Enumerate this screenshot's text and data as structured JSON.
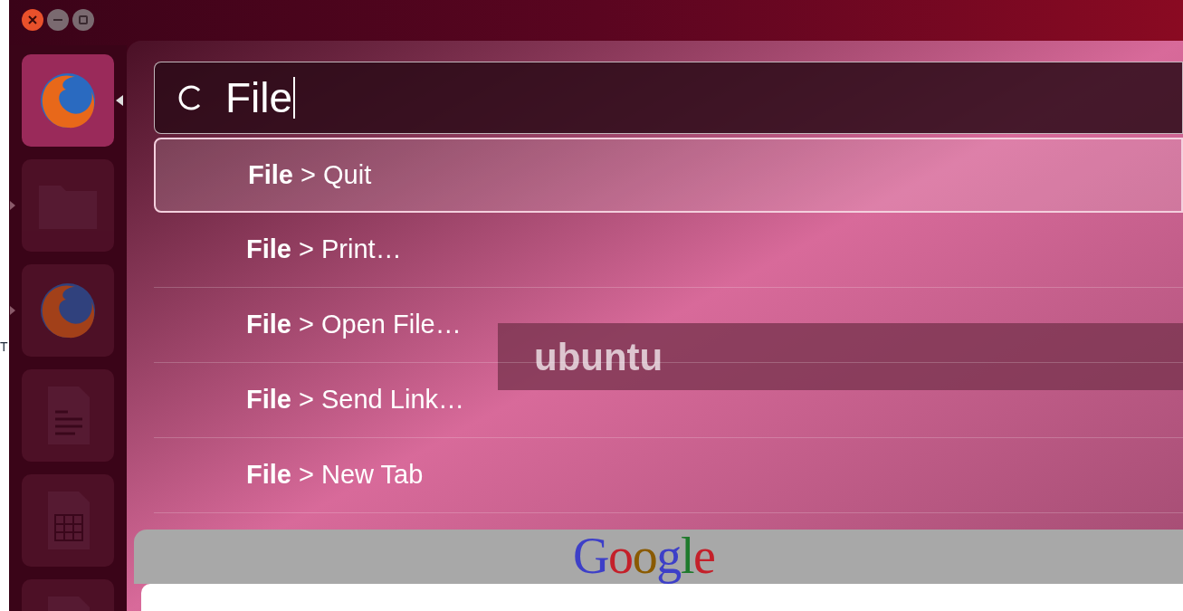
{
  "edge_text": "T",
  "window_controls": [
    {
      "kind": "close"
    },
    {
      "kind": "minimize"
    },
    {
      "kind": "maximize"
    }
  ],
  "launcher": {
    "items": [
      {
        "kind": "firefox",
        "selected": true,
        "running": false
      },
      {
        "kind": "folder",
        "selected": false,
        "running": true
      },
      {
        "kind": "firefox",
        "selected": false,
        "running": true
      },
      {
        "kind": "document",
        "selected": false,
        "running": false
      },
      {
        "kind": "spreadsheet",
        "selected": false,
        "running": false
      },
      {
        "kind": "document",
        "selected": false,
        "running": false
      }
    ]
  },
  "background": {
    "banner": "ubuntu",
    "logo": "Google"
  },
  "hud": {
    "search": {
      "value": "File"
    },
    "results": [
      {
        "text": "**File** > Quit",
        "selected": true
      },
      {
        "text": "**File** > Print…",
        "selected": false
      },
      {
        "text": "**File** > Open File…",
        "selected": false
      },
      {
        "text": "**File** > Send Link…",
        "selected": false
      },
      {
        "text": "**File** > New Tab",
        "selected": false
      }
    ]
  }
}
